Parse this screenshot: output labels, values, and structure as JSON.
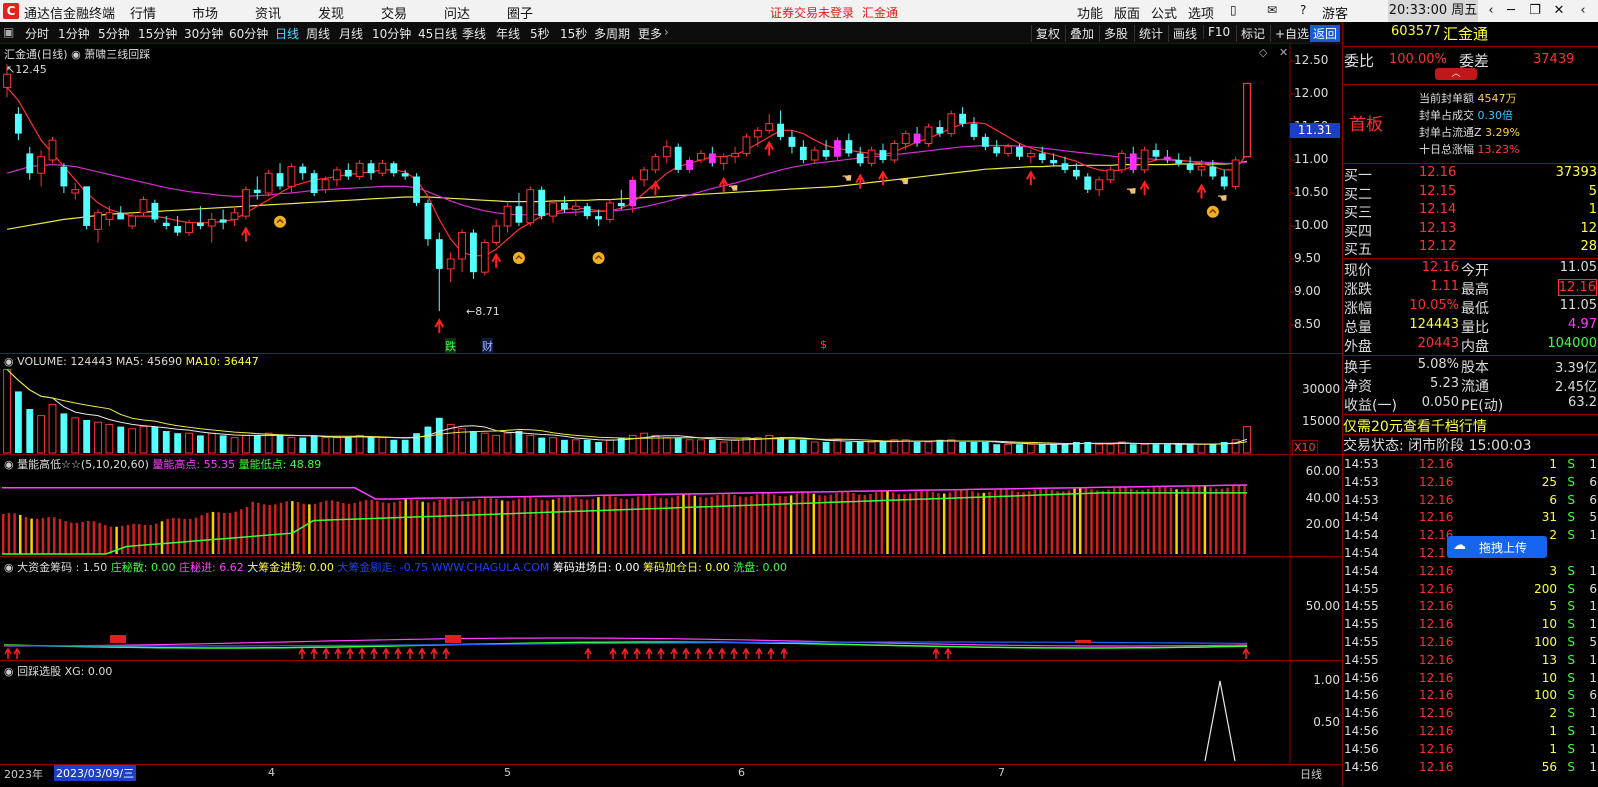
{
  "titlebar": {
    "app_name": "通达信金融终端",
    "menu": [
      "行情",
      "市场",
      "资讯",
      "发现",
      "交易",
      "问达",
      "圈子"
    ],
    "login_notice": "证券交易未登录",
    "stock_name": "汇金通",
    "right_menu": [
      "功能",
      "版面",
      "公式",
      "选项"
    ],
    "user": "游客",
    "clock": "20:33:00 周五"
  },
  "periodbar": {
    "periods": [
      "分时",
      "1分钟",
      "5分钟",
      "15分钟",
      "30分钟",
      "60分钟",
      "日线",
      "周线",
      "月线",
      "10分钟",
      "45日线",
      "季线",
      "年线",
      "5秒",
      "15秒",
      "多周期",
      "更多"
    ],
    "active": "日线",
    "tools": [
      "复权",
      "叠加",
      "多股",
      "统计",
      "画线",
      "F10",
      "标记",
      "+自选",
      "返回"
    ]
  },
  "main_chart": {
    "title": "汇金通(日线)",
    "indicator": "萧啸三线回踩",
    "high_marker": "12.45",
    "low_marker": "8.71",
    "price_axis": [
      "12.50",
      "12.00",
      "11.50",
      "11.00",
      "10.50",
      "10.00",
      "9.50",
      "9.00",
      "8.50"
    ],
    "current_price_tag": "11.31",
    "bottom_marks": [
      "跌",
      "财",
      "$"
    ]
  },
  "volume_panel": {
    "title": "VOLUME: 124443",
    "ma5": "MA5: 45690",
    "ma10": "MA10: 36447",
    "axis": [
      "30000",
      "15000"
    ],
    "unit": "X10"
  },
  "energy_panel": {
    "title": "量能高低☆☆(5,10,20,60)",
    "high": "量能高点: 55.35",
    "low": "量能低点: 48.89",
    "axis": [
      "60.00",
      "40.00",
      "20.00"
    ]
  },
  "fund_panel": {
    "title": "大资金筹码 : 1.50",
    "items": [
      {
        "text": "庄秘散: 0.00",
        "color": "#3cff3c"
      },
      {
        "text": "庄秘进: 6.62",
        "color": "#ff40ff"
      },
      {
        "text": "大筹金进场: 0.00",
        "color": "#ffff40"
      },
      {
        "text": "大筹金剔走: -0.75 WWW.CHAGULA.COM",
        "color": "#2040ff"
      },
      {
        "text": "筹码进场日: 0.00",
        "color": "#ffffff"
      },
      {
        "text": "筹码加仓日: 0.00",
        "color": "#ffff40"
      },
      {
        "text": "洗盘: 0.00",
        "color": "#3cff3c"
      }
    ],
    "axis": [
      "50.00"
    ]
  },
  "pick_panel": {
    "title": "回踩选股 XG: 0.00",
    "axis": [
      "1.00",
      "0.50"
    ]
  },
  "bottom_axis": {
    "left_year": "2023年",
    "date_box": "2023/03/09/三",
    "months": [
      "4",
      "5",
      "6",
      "7"
    ],
    "right_label": "日线"
  },
  "quote": {
    "code": "603577",
    "name": "汇金通",
    "weibi_label": "委比",
    "weibi": "100.00%",
    "weicha_label": "委差",
    "weicha": "37439",
    "board": "首板",
    "seal_lines": [
      {
        "label": "当前封单额",
        "value": "4547万"
      },
      {
        "label": "封单占成交",
        "value": "0.30倍"
      },
      {
        "label": "封单占流通Z",
        "value": "3.29%"
      },
      {
        "label": "十日总涨幅",
        "value": "13.23%"
      }
    ],
    "bids": [
      {
        "label": "买一",
        "price": "12.16",
        "vol": "37393"
      },
      {
        "label": "买二",
        "price": "12.15",
        "vol": "5"
      },
      {
        "label": "买三",
        "price": "12.14",
        "vol": "1"
      },
      {
        "label": "买四",
        "price": "12.13",
        "vol": "12"
      },
      {
        "label": "买五",
        "price": "12.12",
        "vol": "28"
      }
    ],
    "stats": [
      {
        "l1": "现价",
        "v1": "12.16",
        "l2": "今开",
        "v2": "11.05"
      },
      {
        "l1": "涨跌",
        "v1": "1.11",
        "l2": "最高",
        "v2": "12.16"
      },
      {
        "l1": "涨幅",
        "v1": "10.05%",
        "l2": "最低",
        "v2": "11.05"
      },
      {
        "l1": "总量",
        "v1": "124443",
        "l2": "量比",
        "v2": "4.97"
      },
      {
        "l1": "外盘",
        "v1": "20443",
        "l2": "内盘",
        "v2": "104000"
      }
    ],
    "stats2": [
      {
        "l1": "换手",
        "v1": "5.08%",
        "l2": "股本",
        "v2": "3.39亿"
      },
      {
        "l1": "净资",
        "v1": "5.23",
        "l2": "流通",
        "v2": "2.45亿"
      },
      {
        "l1": "收益(一)",
        "v1": "0.050",
        "l2": "PE(动)",
        "v2": "63.2"
      }
    ],
    "promo": "仅需20元查看千档行情",
    "status_label": "交易状态:",
    "status": "闭市阶段 15:00:03",
    "upload_label": "拖拽上传",
    "ticks": [
      {
        "t": "14:53",
        "p": "12.16",
        "v": "1",
        "s": "S",
        "n": "1"
      },
      {
        "t": "14:53",
        "p": "12.16",
        "v": "25",
        "s": "S",
        "n": "6"
      },
      {
        "t": "14:53",
        "p": "12.16",
        "v": "6",
        "s": "S",
        "n": "6"
      },
      {
        "t": "14:54",
        "p": "12.16",
        "v": "31",
        "s": "S",
        "n": "5"
      },
      {
        "t": "14:54",
        "p": "12.16",
        "v": "2",
        "s": "S",
        "n": "1"
      },
      {
        "t": "14:54",
        "p": "12.1",
        "v": "",
        "s": "",
        "n": ""
      },
      {
        "t": "14:54",
        "p": "12.16",
        "v": "3",
        "s": "S",
        "n": "1"
      },
      {
        "t": "14:55",
        "p": "12.16",
        "v": "200",
        "s": "S",
        "n": "6"
      },
      {
        "t": "14:55",
        "p": "12.16",
        "v": "5",
        "s": "S",
        "n": "1"
      },
      {
        "t": "14:55",
        "p": "12.16",
        "v": "10",
        "s": "S",
        "n": "1"
      },
      {
        "t": "14:55",
        "p": "12.16",
        "v": "100",
        "s": "S",
        "n": "5"
      },
      {
        "t": "14:55",
        "p": "12.16",
        "v": "13",
        "s": "S",
        "n": "1"
      },
      {
        "t": "14:56",
        "p": "12.16",
        "v": "10",
        "s": "S",
        "n": "1"
      },
      {
        "t": "14:56",
        "p": "12.16",
        "v": "100",
        "s": "S",
        "n": "6"
      },
      {
        "t": "14:56",
        "p": "12.16",
        "v": "2",
        "s": "S",
        "n": "1"
      },
      {
        "t": "14:56",
        "p": "12.16",
        "v": "1",
        "s": "S",
        "n": "1"
      },
      {
        "t": "14:56",
        "p": "12.16",
        "v": "1",
        "s": "S",
        "n": "1"
      },
      {
        "t": "14:56",
        "p": "12.16",
        "v": "56",
        "s": "S",
        "n": "1"
      }
    ]
  },
  "chart_data": {
    "type": "candlestick",
    "ylim": [
      8.5,
      12.5
    ],
    "candles": [
      [
        12.1,
        12.45,
        11.95,
        12.3
      ],
      [
        11.7,
        11.8,
        11.3,
        11.4
      ],
      [
        11.1,
        11.2,
        10.7,
        10.8
      ],
      [
        10.8,
        11.15,
        10.6,
        11.05
      ],
      [
        11.0,
        11.35,
        10.95,
        11.3
      ],
      [
        10.9,
        10.95,
        10.5,
        10.6
      ],
      [
        10.5,
        10.65,
        10.4,
        10.55
      ],
      [
        10.6,
        10.6,
        9.95,
        10.0
      ],
      [
        9.95,
        10.25,
        9.75,
        10.2
      ],
      [
        10.1,
        10.3,
        10.0,
        10.2
      ],
      [
        10.2,
        10.3,
        10.1,
        10.1
      ],
      [
        10.0,
        10.2,
        9.95,
        10.15
      ],
      [
        10.2,
        10.45,
        10.15,
        10.4
      ],
      [
        10.35,
        10.4,
        10.05,
        10.1
      ],
      [
        10.05,
        10.15,
        9.95,
        10.0
      ],
      [
        10.0,
        10.15,
        9.85,
        9.9
      ],
      [
        9.9,
        10.1,
        9.85,
        10.05
      ],
      [
        10.05,
        10.3,
        9.95,
        10.0
      ],
      [
        10.0,
        10.2,
        9.75,
        10.1
      ],
      [
        10.1,
        10.25,
        9.95,
        10.05
      ],
      [
        10.1,
        10.3,
        10.0,
        10.2
      ],
      [
        10.15,
        10.6,
        10.1,
        10.55
      ],
      [
        10.55,
        10.75,
        10.4,
        10.5
      ],
      [
        10.5,
        10.85,
        10.45,
        10.8
      ],
      [
        10.8,
        10.95,
        10.55,
        10.6
      ],
      [
        10.6,
        10.95,
        10.5,
        10.9
      ],
      [
        10.9,
        10.95,
        10.7,
        10.8
      ],
      [
        10.8,
        10.85,
        10.45,
        10.5
      ],
      [
        10.55,
        10.75,
        10.5,
        10.7
      ],
      [
        10.7,
        10.9,
        10.6,
        10.85
      ],
      [
        10.85,
        10.95,
        10.7,
        10.75
      ],
      [
        10.75,
        11.0,
        10.7,
        10.95
      ],
      [
        10.95,
        11.0,
        10.7,
        10.8
      ],
      [
        10.8,
        11.0,
        10.75,
        10.95
      ],
      [
        10.95,
        10.98,
        10.75,
        10.8
      ],
      [
        10.8,
        10.85,
        10.7,
        10.75
      ],
      [
        10.75,
        10.8,
        10.3,
        10.35
      ],
      [
        10.35,
        10.4,
        9.7,
        9.8
      ],
      [
        9.8,
        9.9,
        8.71,
        9.35
      ],
      [
        9.35,
        9.6,
        9.15,
        9.5
      ],
      [
        9.5,
        9.95,
        9.3,
        9.9
      ],
      [
        9.9,
        9.95,
        9.2,
        9.3
      ],
      [
        9.3,
        9.8,
        9.25,
        9.75
      ],
      [
        9.75,
        10.1,
        9.7,
        10.0
      ],
      [
        10.0,
        10.35,
        9.9,
        10.3
      ],
      [
        10.3,
        10.5,
        10.0,
        10.05
      ],
      [
        10.05,
        10.6,
        10.0,
        10.55
      ],
      [
        10.55,
        10.6,
        10.1,
        10.15
      ],
      [
        10.15,
        10.4,
        10.05,
        10.35
      ],
      [
        10.35,
        10.45,
        10.2,
        10.25
      ],
      [
        10.25,
        10.4,
        10.15,
        10.3
      ],
      [
        10.3,
        10.35,
        10.1,
        10.15
      ],
      [
        10.15,
        10.25,
        10.0,
        10.1
      ],
      [
        10.1,
        10.4,
        10.05,
        10.35
      ],
      [
        10.35,
        10.55,
        10.25,
        10.3
      ],
      [
        10.3,
        10.75,
        10.2,
        10.7
      ],
      [
        10.7,
        10.9,
        10.6,
        10.85
      ],
      [
        10.85,
        11.1,
        10.8,
        11.05
      ],
      [
        11.05,
        11.3,
        10.95,
        11.2
      ],
      [
        11.2,
        11.25,
        10.8,
        10.85
      ],
      [
        10.85,
        11.05,
        10.8,
        11.0
      ],
      [
        11.0,
        11.15,
        10.95,
        11.1
      ],
      [
        11.1,
        11.2,
        10.9,
        10.95
      ],
      [
        10.95,
        11.1,
        10.85,
        11.05
      ],
      [
        11.05,
        11.2,
        10.95,
        11.1
      ],
      [
        11.1,
        11.4,
        11.05,
        11.35
      ],
      [
        11.35,
        11.5,
        11.2,
        11.45
      ],
      [
        11.45,
        11.7,
        11.4,
        11.55
      ],
      [
        11.55,
        11.75,
        11.3,
        11.35
      ],
      [
        11.35,
        11.45,
        11.1,
        11.2
      ],
      [
        11.2,
        11.3,
        10.95,
        11.0
      ],
      [
        11.0,
        11.2,
        10.95,
        11.15
      ],
      [
        11.15,
        11.3,
        11.0,
        11.05
      ],
      [
        11.05,
        11.35,
        11.0,
        11.3
      ],
      [
        11.3,
        11.4,
        11.05,
        11.1
      ],
      [
        11.1,
        11.2,
        10.9,
        10.95
      ],
      [
        10.95,
        11.2,
        10.9,
        11.15
      ],
      [
        11.15,
        11.25,
        10.95,
        11.0
      ],
      [
        11.0,
        11.3,
        10.95,
        11.25
      ],
      [
        11.25,
        11.45,
        11.15,
        11.4
      ],
      [
        11.4,
        11.5,
        11.2,
        11.25
      ],
      [
        11.25,
        11.55,
        11.2,
        11.5
      ],
      [
        11.5,
        11.6,
        11.35,
        11.4
      ],
      [
        11.4,
        11.75,
        11.35,
        11.7
      ],
      [
        11.7,
        11.8,
        11.5,
        11.55
      ],
      [
        11.55,
        11.65,
        11.3,
        11.35
      ],
      [
        11.35,
        11.4,
        11.15,
        11.2
      ],
      [
        11.2,
        11.3,
        11.05,
        11.1
      ],
      [
        11.1,
        11.25,
        11.05,
        11.2
      ],
      [
        11.2,
        11.25,
        11.0,
        11.05
      ],
      [
        11.05,
        11.15,
        10.95,
        11.1
      ],
      [
        11.1,
        11.2,
        10.95,
        11.0
      ],
      [
        11.0,
        11.1,
        10.9,
        10.95
      ],
      [
        10.95,
        11.05,
        10.8,
        10.85
      ],
      [
        10.85,
        10.95,
        10.7,
        10.75
      ],
      [
        10.75,
        10.8,
        10.5,
        10.55
      ],
      [
        10.55,
        10.75,
        10.45,
        10.7
      ],
      [
        10.7,
        10.9,
        10.65,
        10.85
      ],
      [
        10.85,
        11.15,
        10.8,
        11.1
      ],
      [
        11.1,
        11.2,
        10.8,
        10.85
      ],
      [
        10.85,
        11.2,
        10.8,
        11.15
      ],
      [
        11.15,
        11.25,
        11.0,
        11.05
      ],
      [
        11.05,
        11.15,
        10.95,
        11.0
      ],
      [
        11.0,
        11.1,
        10.9,
        10.95
      ],
      [
        10.95,
        11.05,
        10.8,
        10.85
      ],
      [
        10.85,
        11.0,
        10.75,
        10.9
      ],
      [
        10.9,
        11.0,
        10.7,
        10.75
      ],
      [
        10.75,
        10.85,
        10.55,
        10.6
      ],
      [
        10.6,
        11.05,
        10.55,
        11.0
      ],
      [
        11.05,
        12.16,
        11.05,
        12.16
      ]
    ],
    "volumes": [
      38,
      28,
      20,
      17,
      22,
      18,
      16,
      15,
      14,
      13,
      12,
      11,
      12,
      12,
      10,
      9,
      9,
      8,
      9,
      8,
      7,
      8,
      8,
      9,
      8,
      7,
      7,
      8,
      7,
      7,
      7,
      8,
      7,
      7,
      6,
      6,
      9,
      12,
      16,
      13,
      11,
      10,
      9,
      8,
      9,
      10,
      8,
      7,
      7,
      6,
      6,
      6,
      5,
      6,
      7,
      8,
      9,
      8,
      7,
      7,
      6,
      6,
      6,
      5,
      6,
      7,
      7,
      8,
      7,
      6,
      6,
      5,
      5,
      6,
      5,
      5,
      5,
      5,
      6,
      6,
      5,
      5,
      6,
      6,
      5,
      5,
      5,
      4,
      4,
      4,
      4,
      4,
      4,
      4,
      5,
      5,
      4,
      4,
      5,
      4,
      4,
      4,
      4,
      4,
      4,
      4,
      4,
      5,
      6,
      12
    ],
    "ma_red": [
      12.1,
      11.9,
      11.6,
      11.3,
      11.1,
      10.9,
      10.7,
      10.5,
      10.35,
      10.25,
      10.2,
      10.15,
      10.15,
      10.15,
      10.12,
      10.08,
      10.05,
      10.05,
      10.05,
      10.07,
      10.1,
      10.2,
      10.3,
      10.4,
      10.5,
      10.6,
      10.65,
      10.7,
      10.72,
      10.75,
      10.78,
      10.8,
      10.82,
      10.85,
      10.85,
      10.82,
      10.7,
      10.45,
      10.1,
      9.8,
      9.6,
      9.55,
      9.55,
      9.65,
      9.8,
      9.95,
      10.05,
      10.15,
      10.2,
      10.25,
      10.27,
      10.26,
      10.23,
      10.23,
      10.27,
      10.35,
      10.5,
      10.65,
      10.8,
      10.9,
      10.95,
      11.0,
      11.05,
      11.05,
      11.08,
      11.15,
      11.25,
      11.35,
      11.45,
      11.45,
      11.4,
      11.3,
      11.22,
      11.17,
      11.15,
      11.12,
      11.1,
      11.08,
      11.12,
      11.2,
      11.27,
      11.33,
      11.4,
      11.48,
      11.55,
      11.57,
      11.55,
      11.45,
      11.35,
      11.25,
      11.18,
      11.12,
      11.08,
      11.03,
      10.98,
      10.9,
      10.85,
      10.83,
      10.85,
      10.9,
      10.95,
      11.0,
      11.02,
      11.0,
      10.98,
      10.95,
      10.9,
      10.85,
      10.85,
      11.1
    ],
    "ma_magenta": [
      10.8,
      10.85,
      10.9,
      10.92,
      10.93,
      10.92,
      10.9,
      10.86,
      10.82,
      10.78,
      10.74,
      10.7,
      10.66,
      10.62,
      10.58,
      10.55,
      10.52,
      10.5,
      10.48,
      10.46,
      10.45,
      10.45,
      10.46,
      10.47,
      10.49,
      10.5,
      10.52,
      10.54,
      10.55,
      10.56,
      10.57,
      10.58,
      10.59,
      10.6,
      10.6,
      10.6,
      10.58,
      10.52,
      10.45,
      10.38,
      10.32,
      10.27,
      10.23,
      10.2,
      10.18,
      10.17,
      10.17,
      10.18,
      10.19,
      10.2,
      10.21,
      10.22,
      10.22,
      10.23,
      10.24,
      10.26,
      10.29,
      10.33,
      10.37,
      10.42,
      10.47,
      10.52,
      10.57,
      10.61,
      10.65,
      10.7,
      10.75,
      10.8,
      10.85,
      10.89,
      10.92,
      10.95,
      10.97,
      10.99,
      11.01,
      11.03,
      11.05,
      11.06,
      11.08,
      11.1,
      11.12,
      11.14,
      11.16,
      11.18,
      11.2,
      11.21,
      11.22,
      11.22,
      11.22,
      11.21,
      11.2,
      11.18,
      11.16,
      11.14,
      11.12,
      11.1,
      11.08,
      11.06,
      11.04,
      11.03,
      11.02,
      11.01,
      11.0,
      10.99,
      10.98,
      10.97,
      10.96,
      10.95,
      10.95,
      10.97
    ],
    "ma_yellow": [
      9.95,
      9.98,
      10.01,
      10.04,
      10.07,
      10.1,
      10.12,
      10.14,
      10.16,
      10.18,
      10.19,
      10.2,
      10.21,
      10.22,
      10.23,
      10.24,
      10.25,
      10.26,
      10.27,
      10.28,
      10.29,
      10.3,
      10.31,
      10.32,
      10.33,
      10.34,
      10.35,
      10.36,
      10.37,
      10.38,
      10.39,
      10.4,
      10.41,
      10.42,
      10.43,
      10.44,
      10.44,
      10.44,
      10.43,
      10.42,
      10.41,
      10.4,
      10.39,
      10.38,
      10.37,
      10.37,
      10.37,
      10.37,
      10.38,
      10.38,
      10.39,
      10.39,
      10.4,
      10.4,
      10.41,
      10.42,
      10.43,
      10.44,
      10.45,
      10.46,
      10.47,
      10.48,
      10.49,
      10.5,
      10.51,
      10.52,
      10.53,
      10.54,
      10.55,
      10.56,
      10.57,
      10.58,
      10.59,
      10.6,
      10.62,
      10.64,
      10.66,
      10.68,
      10.7,
      10.72,
      10.74,
      10.76,
      10.78,
      10.8,
      10.82,
      10.84,
      10.86,
      10.87,
      10.88,
      10.89,
      10.9,
      10.9,
      10.91,
      10.91,
      10.92,
      10.92,
      10.92,
      10.92,
      10.93,
      10.93,
      10.93,
      10.93,
      10.93,
      10.94,
      10.94,
      10.94,
      10.94,
      10.94,
      10.95,
      10.98
    ]
  }
}
